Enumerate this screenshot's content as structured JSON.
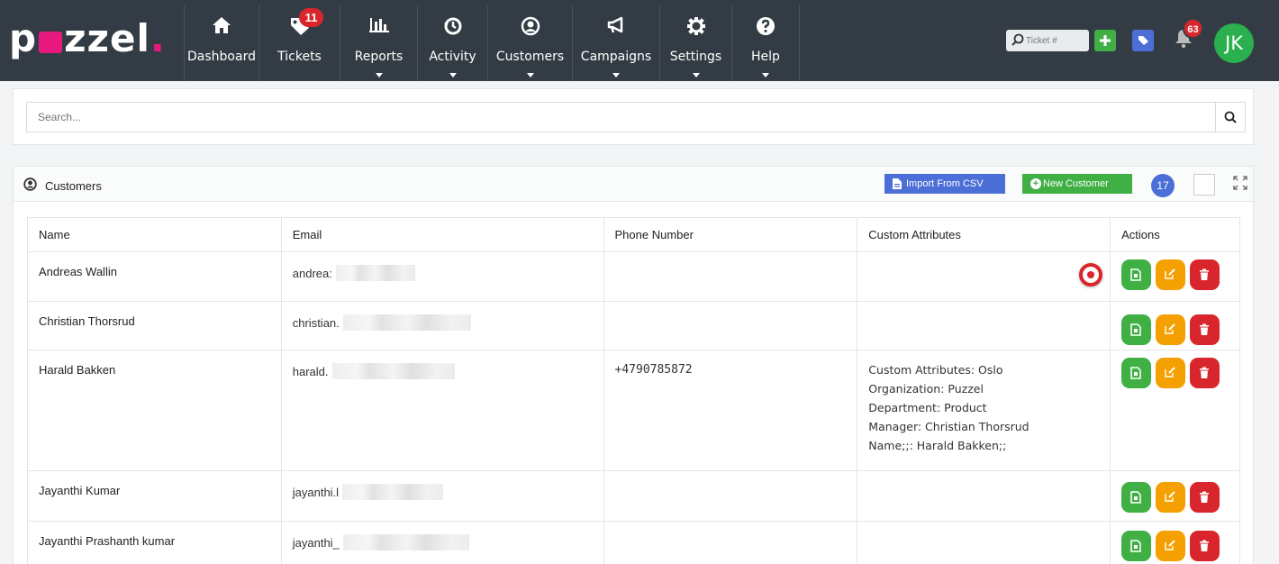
{
  "app": {
    "logo": {
      "pre": "p",
      "post": "zzel",
      "dot": "."
    }
  },
  "nav": [
    {
      "label": "Dashboard",
      "icon": "home-icon"
    },
    {
      "label": "Tickets",
      "icon": "tag-icon",
      "badge": "11"
    },
    {
      "label": "Reports",
      "icon": "bar-chart-icon"
    },
    {
      "label": "Activity",
      "icon": "history-icon"
    },
    {
      "label": "Customers",
      "icon": "user-circle-icon"
    },
    {
      "label": "Campaigns",
      "icon": "megaphone-icon"
    },
    {
      "label": "Settings",
      "icon": "gear-icon"
    },
    {
      "label": "Help",
      "icon": "question-icon"
    }
  ],
  "topright": {
    "ticket_placeholder": "Ticket #",
    "notifications_count": "63",
    "avatar_initials": "JK"
  },
  "search": {
    "placeholder": "Search..."
  },
  "panel": {
    "title": "Customers",
    "import_label": "Import From CSV",
    "new_label": "New Customer",
    "count": "17"
  },
  "table": {
    "headers": [
      "Name",
      "Email",
      "Phone Number",
      "Custom Attributes",
      "Actions"
    ],
    "rows": [
      {
        "name": "Andreas Wallin",
        "email": "andrea:",
        "phone": "",
        "attrs": []
      },
      {
        "name": "Christian Thorsrud",
        "email": "christian.",
        "phone": "",
        "attrs": []
      },
      {
        "name": "Harald Bakken",
        "email": "harald.",
        "phone": "+4790785872",
        "attrs": [
          "Custom Attributes: Oslo",
          "Organization: Puzzel",
          "Department: Product",
          "Manager: Christian Thorsrud",
          "Name;;: Harald Bakken;;"
        ]
      },
      {
        "name": "Jayanthi Kumar",
        "email": "jayanthi.l",
        "phone": "",
        "attrs": []
      },
      {
        "name": "Jayanthi Prashanth kumar",
        "email": "jayanthi_",
        "phone": "",
        "attrs": []
      }
    ]
  },
  "colors": {
    "navbar": "#333c44",
    "brand_pink": "#e8197e",
    "green": "#40b045",
    "orange": "#f5a001",
    "red": "#d9262c",
    "blue": "#4b6fd6"
  }
}
